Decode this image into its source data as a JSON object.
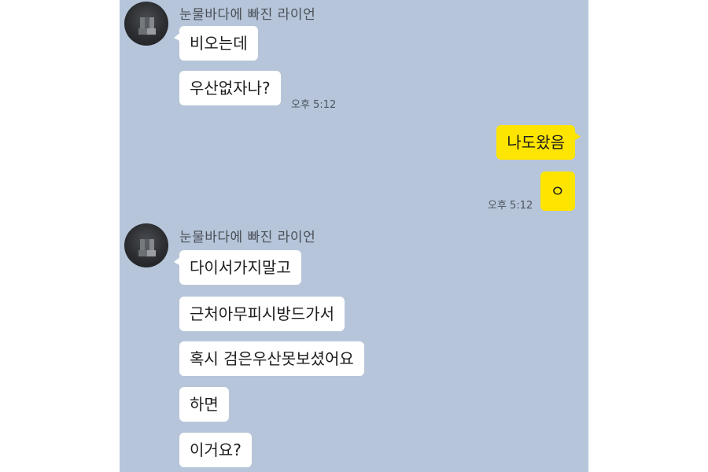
{
  "chat": {
    "groups": [
      {
        "sender": "눈물바다에 빠진 라이언",
        "messages": [
          "비오는데",
          "우산없자나?"
        ],
        "time": "오후 5:12"
      },
      {
        "mine": true,
        "messages": [
          "나도왔음",
          "ㅇ"
        ],
        "time": "오후 5:12"
      },
      {
        "sender": "눈물바다에 빠진 라이언",
        "messages": [
          "다이서가지말고",
          "근처아무피시방드가서",
          "혹시 검은우산못보셨어요",
          "하면",
          "이거요?"
        ]
      }
    ]
  },
  "colors": {
    "background": "#b6c5d9",
    "incoming_bubble": "#ffffff",
    "outgoing_bubble": "#fee500"
  }
}
